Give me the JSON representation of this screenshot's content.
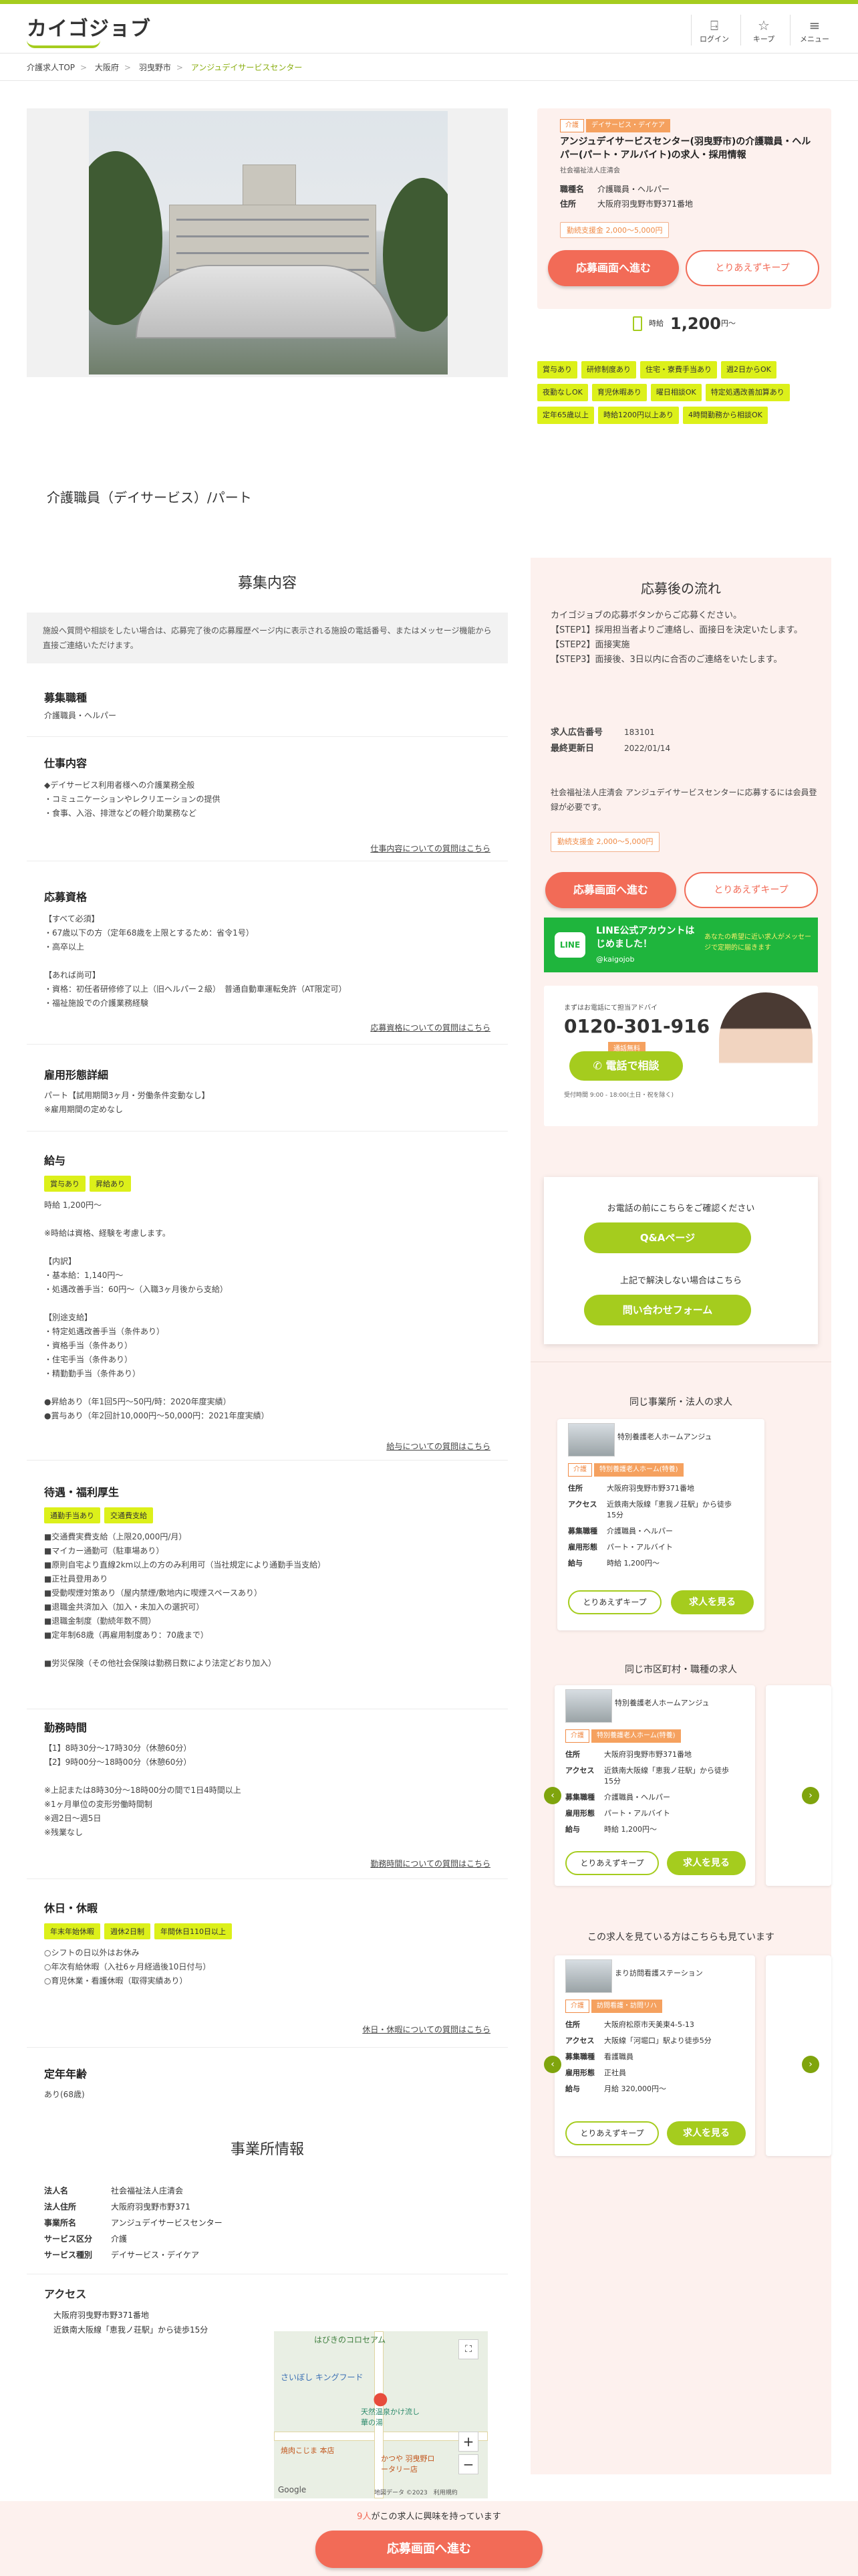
{
  "header": {
    "logo": "カイゴジョブ",
    "nav": [
      {
        "icon": "login-icon",
        "label": "ログイン"
      },
      {
        "icon": "keep-icon",
        "label": "キープ"
      },
      {
        "icon": "menu-icon",
        "label": "メニュー"
      }
    ]
  },
  "breadcrumb": [
    "介護求人TOP",
    "大阪府",
    "羽曳野市",
    "アンジュデイサービスセンター"
  ],
  "job_card": {
    "tags": [
      "介護",
      "デイサービス・デイケア"
    ],
    "title": "アンジュデイサービスセンター(羽曳野市)の介護職員・ヘルパー(パート・アルバイト)の求人・採用情報",
    "corp": "社会福祉法人庄清会",
    "fields": [
      {
        "key": "職種名",
        "value": "介護職員・ヘルパー"
      },
      {
        "key": "住所",
        "value": "大阪府羽曳野市野371番地"
      }
    ],
    "bonus": "勤続支援金 2,000～5,000円",
    "apply_label": "応募画面へ進む",
    "keep_label": "とりあえずキープ"
  },
  "wage": {
    "label": "時給",
    "amount": "1,200",
    "suffix": "円～"
  },
  "features": [
    "賞与あり",
    "研修制度あり",
    "住宅・寮費手当あり",
    "週2日からOK",
    "夜勤なしOK",
    "育児休暇あり",
    "曜日相談OK",
    "特定処遇改善加算あり",
    "定年65歳以上",
    "時給1200円以上あり",
    "4時間勤務から相談OK"
  ],
  "job_title": "介護職員（デイサービス）/パート",
  "recruit": {
    "heading": "募集内容",
    "notice": "施設へ質問や相談をしたい場合は、応募完了後の応募履歴ページ内に表示される施設の電話番号、またはメッセージ機能から直接ご連絡いただけます。",
    "sections": [
      {
        "title": "募集職種",
        "body": "介護職員・ヘルパー"
      },
      {
        "title": "仕事内容",
        "body": "◆デイサービス利用者様への介護業務全般\n・コミュニケーションやレクリエーションの提供\n・食事、入浴、排泄などの軽介助業務など",
        "link": "仕事内容についての質問はこちら"
      },
      {
        "title": "応募資格",
        "body": "【すべて必須】\n・67歳以下の方（定年68歳を上限とするため：省令1号）\n・高卒以上\n\n【あれば尚可】\n・資格：初任者研修修了以上（旧ヘルパー２級）　普通自動車運転免許（AT限定可）\n・福祉施設での介護業務経験",
        "link": "応募資格についての質問はこちら"
      },
      {
        "title": "雇用形態詳細",
        "body": "パート【試用期間3ヶ月・労働条件変動なし】\n※雇用期間の定めなし"
      },
      {
        "title": "給与",
        "badges": [
          "賞与あり",
          "昇給あり"
        ],
        "body": "時給 1,200円～\n\n※時給は資格、経験を考慮します。\n\n【内訳】\n・基本給：1,140円～\n・処遇改善手当：60円～（入職3ヶ月後から支給）\n\n【別途支給】\n・特定処遇改善手当（条件あり）\n・資格手当（条件あり）\n・住宅手当（条件あり）\n・精勤勤手当（条件あり）\n\n●昇給あり（年1回5円～50円/時：2020年度実績）\n●賞与あり（年2回計10,000円～50,000円：2021年度実績）",
        "link": "給与についての質問はこちら"
      },
      {
        "title": "待遇・福利厚生",
        "badges": [
          "通勤手当あり",
          "交通費支給"
        ],
        "body": "■交通費実費支給（上限20,000円/月）\n■マイカー通勤可（駐車場あり）\n■原則自宅より直線2km以上の方のみ利用可（当社規定により通勤手当支給）\n■正社員登用あり\n■受動喫煙対策あり（屋内禁煙/敷地内に喫煙スペースあり）\n■退職金共済加入（加入・未加入の選択可）\n■退職金制度（勤続年数不問）\n■定年制68歳（再雇用制度あり：70歳まで）\n\n■労災保険（その他社会保険は勤務日数により法定どおり加入）"
      },
      {
        "title": "勤務時間",
        "body": "【1】8時30分～17時30分（休憩60分）\n【2】9時00分～18時00分（休憩60分）\n\n※上記または8時30分～18時00分の間で1日4時間以上\n※1ヶ月単位の変形労働時間制\n※週2日～週5日\n※残業なし",
        "link": "勤務時間についての質問はこちら"
      },
      {
        "title": "休日・休暇",
        "badges": [
          "年末年始休暇",
          "週休2日制",
          "年間休日110日以上"
        ],
        "body": "○シフトの日以外はお休み\n○年次有給休暇（入社6ヶ月経過後10日付与）\n○育児休業・看護休暇（取得実績あり）",
        "link": "休日・休暇についての質問はこちら"
      },
      {
        "title": "定年年齢",
        "body": "あり(68歳)"
      }
    ]
  },
  "office": {
    "heading": "事業所情報",
    "rows": [
      {
        "key": "法人名",
        "value": "社会福祉法人庄清会"
      },
      {
        "key": "法人住所",
        "value": "大阪府羽曳野市野371"
      },
      {
        "key": "事業所名",
        "value": "アンジュデイサービスセンター"
      },
      {
        "key": "サービス区分",
        "value": "介護"
      },
      {
        "key": "サービス種別",
        "value": "デイサービス・デイケア"
      }
    ],
    "access_title": "アクセス",
    "address": "大阪府羽曳野市野371番地",
    "station": "近鉄南大阪線「恵我ノ荘駅」から徒歩15分",
    "map_labels": [
      "はびきのコロセアム",
      "さいぼし キングフード",
      "天然温泉かけ流し 華の湯",
      "焼肉こじま 本店",
      "かつや 羽曳野ロータリー店",
      "Google",
      "地図データ ©2023",
      "利用規約"
    ]
  },
  "side": {
    "flow_heading": "応募後の流れ",
    "flow_text": "カイゴジョブの応募ボタンからご応募ください。\n【STEP1】採用担当者よりご連絡し、面接日を決定いたします。\n【STEP2】面接実施\n【STEP3】面接後、3日以内に合否のご連絡をいたします。",
    "ad_no_label": "求人広告番号",
    "ad_no": "183101",
    "updated_label": "最終更新日",
    "updated": "2022/01/14",
    "member_note": "社会福祉法人庄清会 アンジュデイサービスセンターに応募するには会員登録が必要です。",
    "bonus": "勤続支援金 2,000～5,000円",
    "apply_label": "応募画面へ進む",
    "keep_label": "とりあえずキープ",
    "line_title": "LINE公式アカウントはじめました！",
    "line_id": "@kaigojob",
    "line_desc": "あなたの希望に近い求人がメッセージで定期的に届きます",
    "tel_lead": "まずはお電話にて担当アドバイ",
    "tel_number": "0120-301-916",
    "tel_free": "通話無料",
    "tel_button": "電話で相談",
    "tel_hours": "受付時間 9:00 - 18:00(土日・祝を除く)",
    "faq_lead": "お電話の前にこちらをご確認ください",
    "faq_button": "Q&Aページ",
    "contact_lead": "上記で解決しない場合はこちら",
    "contact_button": "問い合わせフォーム",
    "same_office_heading": "同じ事業所・法人の求人",
    "same_area_heading": "同じ市区町村・職種の求人",
    "others_heading": "この求人を見ている方はこちらも見ています"
  },
  "mini_cards": [
    {
      "title": "特別養護老人ホームアンジュ",
      "tag_a": "介護",
      "tag_b": "特別養護老人ホーム(特養)",
      "rows": [
        {
          "key": "住所",
          "value": "大阪府羽曳野市野371番地"
        },
        {
          "key": "アクセス",
          "value": "近鉄南大阪線「恵我ノ荘駅」から徒歩15分"
        },
        {
          "key": "募集職種",
          "value": "介護職員・ヘルパー"
        },
        {
          "key": "雇用形態",
          "value": "パート・アルバイト"
        },
        {
          "key": "給与",
          "value": "時給 1,200円～"
        }
      ],
      "keep": "とりあえずキープ",
      "see": "求人を見る"
    },
    {
      "title": "特別養護老人ホームアンジュ",
      "tag_a": "介護",
      "tag_b": "特別養護老人ホーム(特養)",
      "rows": [
        {
          "key": "住所",
          "value": "大阪府羽曳野市野371番地"
        },
        {
          "key": "アクセス",
          "value": "近鉄南大阪線「恵我ノ荘駅」から徒歩15分"
        },
        {
          "key": "募集職種",
          "value": "介護職員・ヘルパー"
        },
        {
          "key": "雇用形態",
          "value": "パート・アルバイト"
        },
        {
          "key": "給与",
          "value": "時給 1,200円～"
        }
      ],
      "keep": "とりあえずキープ",
      "see": "求人を見る"
    },
    {
      "title": "まり訪問看護ステーション",
      "tag_a": "介護",
      "tag_b": "訪問看護・訪問リハ",
      "rows": [
        {
          "key": "住所",
          "value": "大阪府松原市天美東4-5-13"
        },
        {
          "key": "アクセス",
          "value": "大阪線「河堀口」駅より徒歩5分"
        },
        {
          "key": "募集職種",
          "value": "看護職員"
        },
        {
          "key": "雇用形態",
          "value": "正社員"
        },
        {
          "key": "給与",
          "value": "月給 320,000円～"
        }
      ],
      "keep": "とりあえずキープ",
      "see": "求人を見る"
    }
  ],
  "bottom": {
    "count": "9人",
    "count_suffix": "がこの求人に興味を持っています",
    "apply_label": "応募画面へ進む"
  },
  "colors": {
    "brand": "#a5cc1e",
    "apply": "#f26b57",
    "feature": "#dcf01a"
  }
}
